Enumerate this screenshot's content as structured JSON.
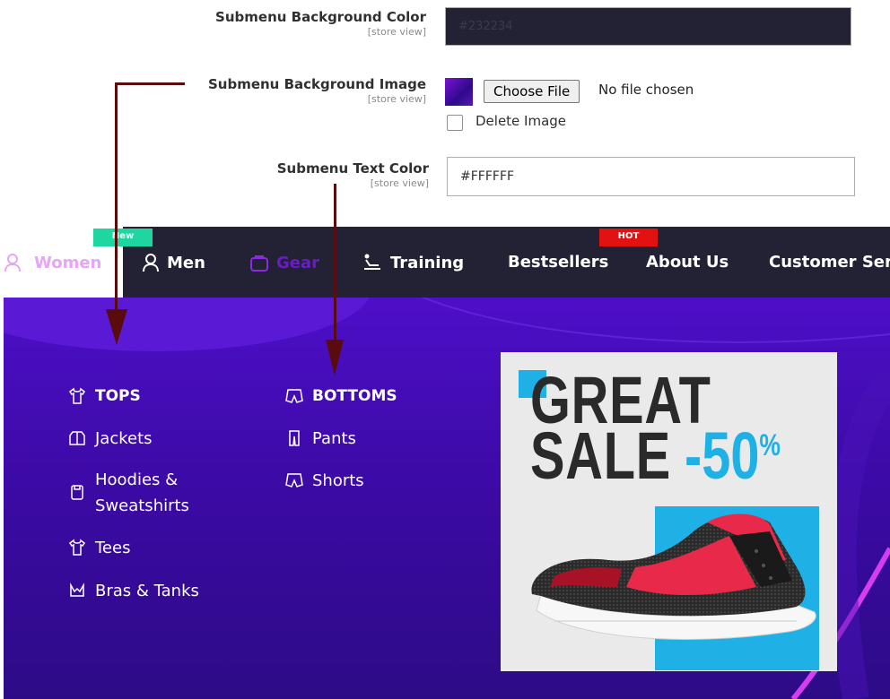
{
  "config": {
    "bg_color": {
      "label": "Submenu Background Color",
      "scope": "[store view]",
      "value": "#232234"
    },
    "bg_image": {
      "label": "Submenu Background Image",
      "scope": "[store view]",
      "button": "Choose File",
      "status": "No file chosen",
      "delete_label": "Delete Image"
    },
    "text_color": {
      "label": "Submenu Text Color",
      "scope": "[store view]",
      "value": "#FFFFFF"
    }
  },
  "nav": {
    "items": [
      {
        "label": "Women",
        "icon": "woman-icon",
        "badge": ""
      },
      {
        "label": "Men",
        "icon": "man-icon",
        "badge": ""
      },
      {
        "label": "Gear",
        "icon": "gear-bag-icon",
        "badge": "New"
      },
      {
        "label": "Training",
        "icon": "treadmill-icon",
        "badge": ""
      },
      {
        "label": "Bestsellers",
        "icon": "",
        "badge": "HOT"
      },
      {
        "label": "About Us",
        "icon": "",
        "badge": ""
      },
      {
        "label": "Customer Ser",
        "icon": "",
        "badge": ""
      }
    ],
    "badge_new_color": "#1ed6a0",
    "badge_hot_color": "#e31212"
  },
  "submenu": {
    "tops": {
      "heading": "TOPS",
      "items": [
        "Jackets",
        "Hoodies & Sweatshirts",
        "Tees",
        "Bras & Tanks"
      ]
    },
    "bottoms": {
      "heading": "BOTTOMS",
      "items": [
        "Pants",
        "Shorts"
      ]
    },
    "promo": {
      "line1": "GREAT",
      "line2": "SALE",
      "discount": "-50",
      "percent": "%"
    }
  },
  "colors": {
    "panel": "#3c0aa6",
    "navbar": "#232234",
    "accent_pink": "#d63cf0",
    "arrow": "#5a0b0b",
    "promo_cyan": "#1fb1e6"
  }
}
